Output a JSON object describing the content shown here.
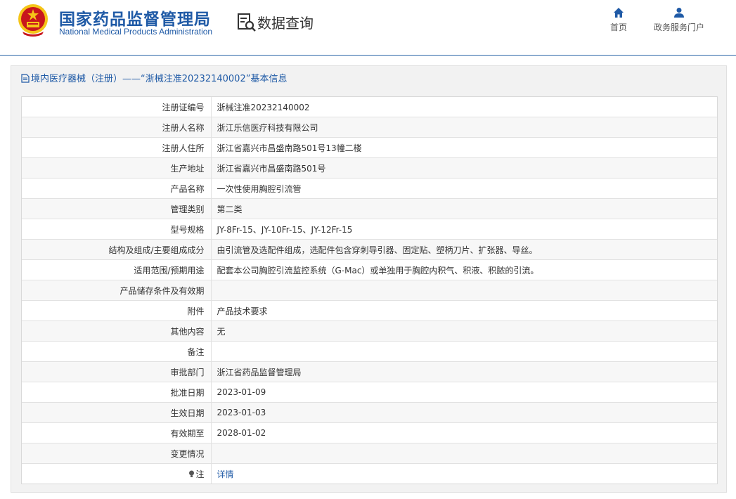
{
  "header": {
    "site_name_cn": "国家药品监督管理局",
    "site_name_en": "National Medical Products Administration",
    "query_title": "数据查询",
    "nav": [
      {
        "label": "首页",
        "icon": "home-icon"
      },
      {
        "label": "政务服务门户",
        "icon": "user-icon"
      }
    ]
  },
  "panel": {
    "title": "境内医疗器械（注册）——“浙械注准20232140002”基本信息"
  },
  "rows": [
    {
      "label": "注册证编号",
      "value": "浙械注准20232140002"
    },
    {
      "label": "注册人名称",
      "value": "浙江乐信医疗科技有限公司"
    },
    {
      "label": "注册人住所",
      "value": "浙江省嘉兴市昌盛南路501号13幢二楼"
    },
    {
      "label": "生产地址",
      "value": "浙江省嘉兴市昌盛南路501号"
    },
    {
      "label": "产品名称",
      "value": "一次性使用胸腔引流管"
    },
    {
      "label": "管理类别",
      "value": "第二类"
    },
    {
      "label": "型号规格",
      "value": "JY-8Fr-15、JY-10Fr-15、JY-12Fr-15"
    },
    {
      "label": "结构及组成/主要组成成分",
      "value": "由引流管及选配件组成，选配件包含穿刺导引器、固定贴、塑柄刀片、扩张器、导丝。"
    },
    {
      "label": "适用范围/预期用途",
      "value": "配套本公司胸腔引流监控系统（G-Mac）或单独用于胸腔内积气、积液、积脓的引流。"
    },
    {
      "label": "产品储存条件及有效期",
      "value": ""
    },
    {
      "label": "附件",
      "value": "产品技术要求"
    },
    {
      "label": "其他内容",
      "value": "无"
    },
    {
      "label": "备注",
      "value": ""
    },
    {
      "label": "审批部门",
      "value": "浙江省药品监督管理局"
    },
    {
      "label": "批准日期",
      "value": "2023-01-09"
    },
    {
      "label": "生效日期",
      "value": "2023-01-03"
    },
    {
      "label": "有效期至",
      "value": "2028-01-02"
    },
    {
      "label": "变更情况",
      "value": ""
    },
    {
      "label": "注",
      "value": "详情",
      "icon": "bulb-icon"
    }
  ],
  "colors": {
    "brand": "#1f5aa6",
    "emblem_red": "#c8161d",
    "emblem_gold": "#f5c518"
  }
}
